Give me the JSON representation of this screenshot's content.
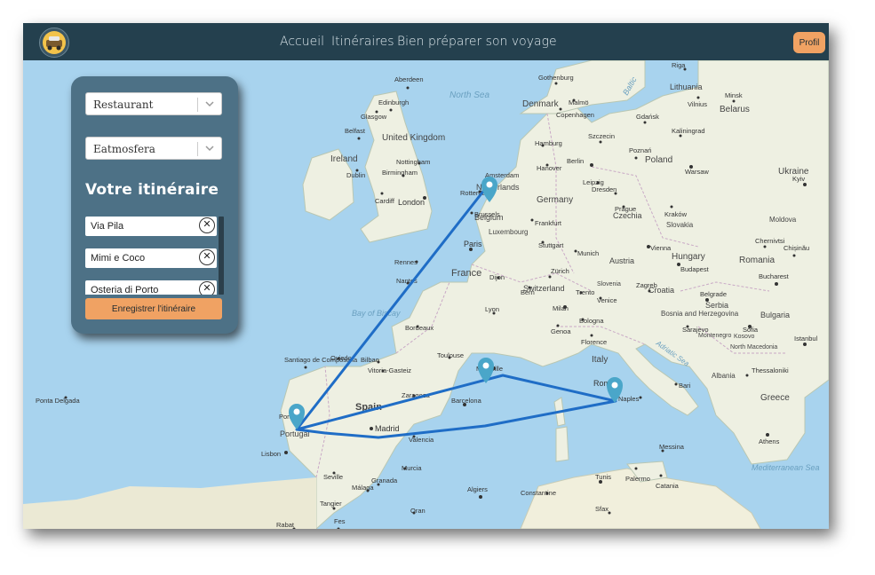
{
  "nav": {
    "links": [
      "Accueil",
      "Itinéraires",
      "Bien préparer son voyage"
    ],
    "profile_label": "Profil"
  },
  "sidebar": {
    "filter_category": "Restaurant",
    "filter_place": "Eatmosfera",
    "title": "Votre itinéraire",
    "stops": [
      "Via Pila",
      "Mimi e Coco",
      "Osteria di Porto"
    ],
    "save_label": "Enregistrer l'itinéraire"
  },
  "map": {
    "countries": [
      "Ireland",
      "United Kingdom",
      "Netherlands",
      "Belgium",
      "Luxembourg",
      "Germany",
      "Denmark",
      "Poland",
      "Czechia",
      "Slovakia",
      "Austria",
      "Hungary",
      "Switzerland",
      "France",
      "Spain",
      "Portugal",
      "Italy",
      "Croatia",
      "Bosnia and Herzegovina",
      "Serbia",
      "Romania",
      "Bulgaria",
      "Moldova",
      "Ukraine",
      "Belarus",
      "Lithuania",
      "Greece",
      "Albania",
      "North Macedonia",
      "Montenegro",
      "Kosovo",
      "Slovenia"
    ],
    "seas": [
      "North Sea",
      "Bay of Biscay",
      "Adriatic Sea",
      "Mediterranean Sea",
      "Baltic"
    ],
    "cities": [
      "Aberdeen",
      "Edinburgh",
      "Glasgow",
      "Belfast",
      "Dublin",
      "Nottingham",
      "Birmingham",
      "Cardiff",
      "London",
      "Amsterdam",
      "Rotterdam",
      "Brussels",
      "Paris",
      "Rennes",
      "Nantes",
      "Bordeaux",
      "Toulouse",
      "Marseille",
      "Lyon",
      "Dijon",
      "Zürich",
      "Milan",
      "Genoa",
      "Florence",
      "Rome",
      "Naples",
      "Bari",
      "Palermo",
      "Catania",
      "Messina",
      "Hamburg",
      "Berlin",
      "Hanover",
      "Frankfurt",
      "Stuttgart",
      "Munich",
      "Dresden",
      "Leipzig",
      "Prague",
      "Vienna",
      "Budapest",
      "Zagreb",
      "Belgrade",
      "Sarajevo",
      "Bucharest",
      "Sofia",
      "Istanbul",
      "Athens",
      "Thessaloniki",
      "Warsaw",
      "Kraków",
      "Poznań",
      "Gdańsk",
      "Szczecin",
      "Kyiv",
      "Minsk",
      "Vilnius",
      "Riga",
      "Copenhagen",
      "Gothenburg",
      "Malmö",
      "Madrid",
      "Barcelona",
      "Valencia",
      "Zaragoza",
      "Bilbao",
      "Seville",
      "Málaga",
      "Murcia",
      "Granada",
      "Lisbon",
      "Porto",
      "Algiers",
      "Tunis",
      "Oran",
      "Constantine",
      "Tangier",
      "Rabat",
      "Fes",
      "Sfax",
      "Ponta Delgada",
      "Santiago de Compostela",
      "Oviedo",
      "Vitoria-Gasteiz",
      "Trento",
      "Venice",
      "Bologna",
      "Bern",
      "Kaliningrad",
      "Chernivtsi",
      "Chișinău"
    ],
    "route_markers": [
      "Porto",
      "Amsterdam",
      "Marseille",
      "Rome"
    ]
  }
}
